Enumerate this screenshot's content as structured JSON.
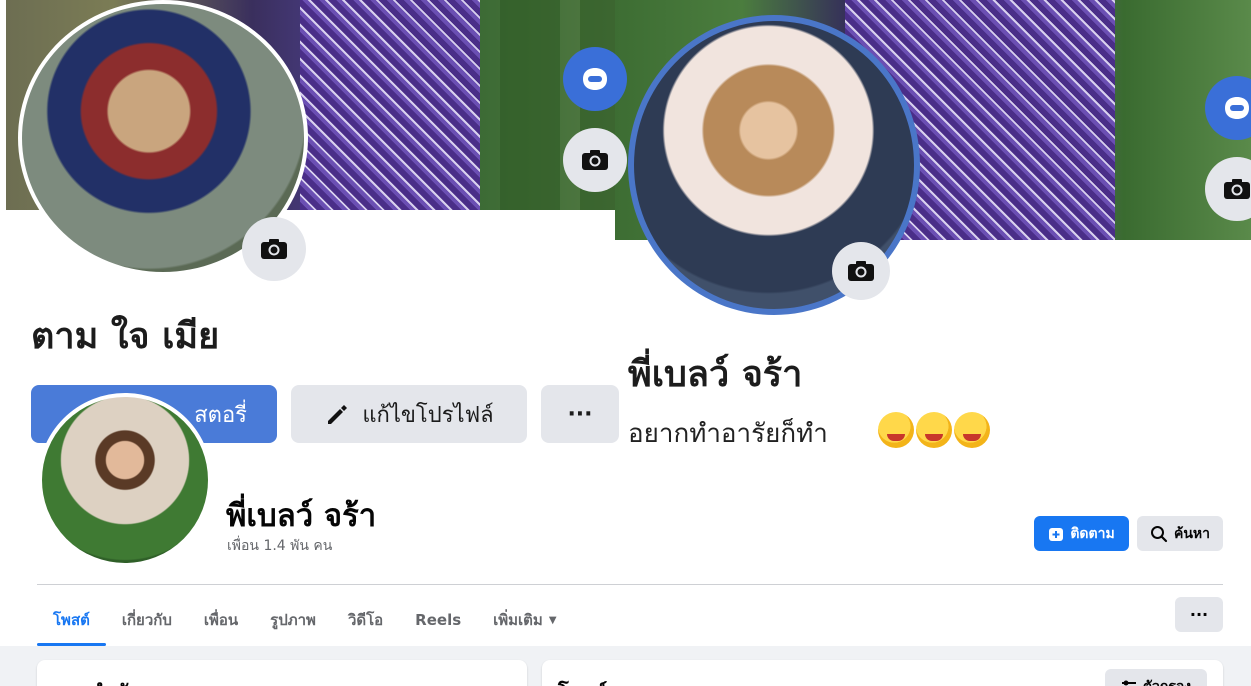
{
  "background_post": {
    "left_name": "ตาม ใจ เมีย",
    "story_button_label": "สตอรี่",
    "edit_profile_label": "แก้ไขโปรไฟล์",
    "more_label": "···",
    "right_name": "พี่เบลว์ จร้า",
    "bio": "อยากทำอารัยก็ทำ"
  },
  "profile": {
    "name": "พี่เบลว์ จร้า",
    "friends": "เพื่อน 1.4 พัน คน",
    "follow_label": "ติดตาม",
    "search_label": "ค้นหา"
  },
  "tabs": [
    {
      "label": "โพสต์"
    },
    {
      "label": "เกี่ยวกับ"
    },
    {
      "label": "เพื่อน"
    },
    {
      "label": "รูปภาพ"
    },
    {
      "label": "วิดีโอ"
    },
    {
      "label": "Reels"
    },
    {
      "label": "เพิ่มเติม"
    }
  ],
  "tabs_more_label": "···",
  "cards": {
    "left_title": "แนะนำตัว",
    "right_title": "โพสต์",
    "filter_label": "ตัวกรอง"
  },
  "colors": {
    "accent": "#1877f2",
    "button_gray": "#e4e6eb",
    "story_blue": "#4a7bd8"
  },
  "icons": [
    "camera-icon",
    "avatar-icon",
    "pencil-icon",
    "plus-icon",
    "search-icon",
    "filter-icon",
    "chevron-down-icon"
  ]
}
